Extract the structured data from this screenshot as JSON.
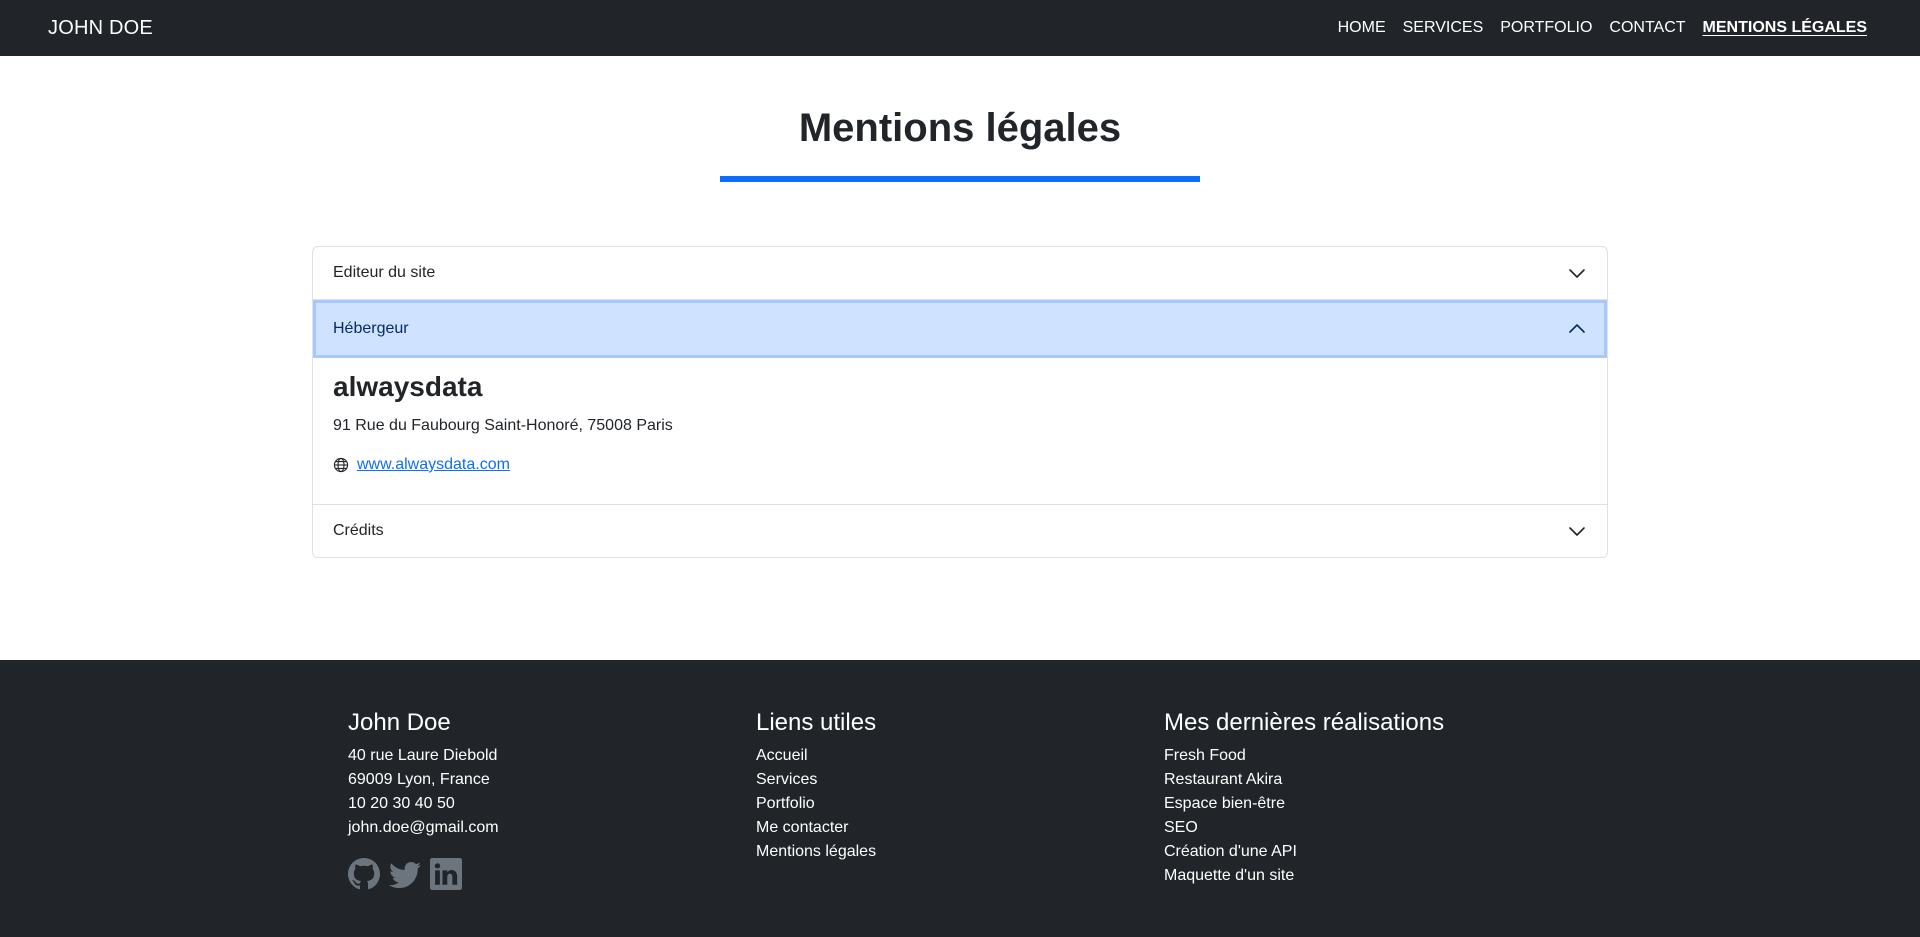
{
  "nav": {
    "brand": "JOHN DOE",
    "links": [
      "HOME",
      "SERVICES",
      "PORTFOLIO",
      "CONTACT",
      "MENTIONS LÉGALES"
    ]
  },
  "page": {
    "title": "Mentions légales"
  },
  "accordion": {
    "items": [
      {
        "label": "Editeur du site",
        "expanded": false
      },
      {
        "label": "Hébergeur",
        "expanded": true
      },
      {
        "label": "Crédits",
        "expanded": false
      }
    ],
    "host": {
      "name": "alwaysdata",
      "address": "91 Rue du Faubourg Saint-Honoré, 75008 Paris",
      "website": "www.alwaysdata.com",
      "icon": "globe-icon"
    }
  },
  "footer": {
    "contact": {
      "heading": "John Doe",
      "lines": [
        "40 rue Laure Diebold",
        "69009 Lyon, France",
        "10 20 30 40 50",
        "john.doe@gmail.com"
      ],
      "social_icons": [
        "github-icon",
        "twitter-icon",
        "linkedin-icon"
      ]
    },
    "links": {
      "heading": "Liens utiles",
      "items": [
        "Accueil",
        "Services",
        "Portfolio",
        "Me contacter",
        "Mentions légales"
      ]
    },
    "projects": {
      "heading": "Mes dernières réalisations",
      "items": [
        "Fresh Food",
        "Restaurant Akira",
        "Espace bien-être",
        "SEO",
        "Création d'une API",
        "Maquette d'un site"
      ]
    }
  },
  "colors": {
    "dark": "#212529",
    "accent": "#0d6efd",
    "accordion_active": "#cfe2ff",
    "social_icon": "#6c757d"
  }
}
